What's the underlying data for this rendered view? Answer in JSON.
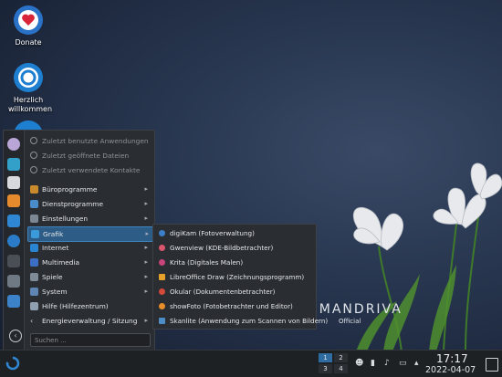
{
  "desktop": {
    "icons": [
      {
        "label": "Donate",
        "icon": "heart-donate-icon"
      },
      {
        "label": "Herzlich willkommen",
        "icon": "openmandriva-welcome-icon"
      }
    ],
    "branding": {
      "name": "OPENMANDRIVA",
      "sub": "Official"
    }
  },
  "menu": {
    "recent": [
      {
        "label": "Zuletzt benutzte Anwendungen"
      },
      {
        "label": "Zuletzt geöffnete Dateien"
      },
      {
        "label": "Zuletzt verwendete Kontakte"
      }
    ],
    "categories": [
      {
        "label": "Büroprogramme",
        "color": "#c98a2e"
      },
      {
        "label": "Dienstprogramme",
        "color": "#4a8bc9"
      },
      {
        "label": "Einstellungen",
        "color": "#7c8794"
      },
      {
        "label": "Grafik",
        "color": "#3b9ad9"
      },
      {
        "label": "Internet",
        "color": "#2a84d2"
      },
      {
        "label": "Multimedia",
        "color": "#3c6fc4"
      },
      {
        "label": "Spiele",
        "color": "#7f8b97"
      },
      {
        "label": "System",
        "color": "#5f86b3"
      },
      {
        "label": "Hilfe (Hilfezentrum)",
        "color": "#8fa0b0"
      },
      {
        "label": "Energieverwaltung / Sitzung",
        "color": "#b0b8c0"
      }
    ],
    "search_placeholder": "Suchen ..."
  },
  "submenu": {
    "items": [
      {
        "label": "digiKam (Fotoverwaltung)",
        "color": "#3c7fc8"
      },
      {
        "label": "Gwenview (KDE-Bildbetrachter)",
        "color": "#d9566e"
      },
      {
        "label": "Krita (Digitales Malen)",
        "color": "#c9447a"
      },
      {
        "label": "LibreOffice Draw (Zeichnungsprogramm)",
        "color": "#e5a12a"
      },
      {
        "label": "Okular (Dokumentenbetrachter)",
        "color": "#d44a3a"
      },
      {
        "label": "showFoto (Fotobetrachter und Editor)",
        "color": "#e98c2a"
      },
      {
        "label": "Skanlite (Anwendung zum Scannen von Bildern)",
        "color": "#4e8cc6"
      }
    ]
  },
  "taskbar": {
    "pager": [
      "1",
      "2",
      "3",
      "4"
    ],
    "time": "17:17",
    "date": "2022-04-07"
  },
  "colors": {
    "accent": "#2d5d86",
    "accent_border": "#3f84be"
  }
}
